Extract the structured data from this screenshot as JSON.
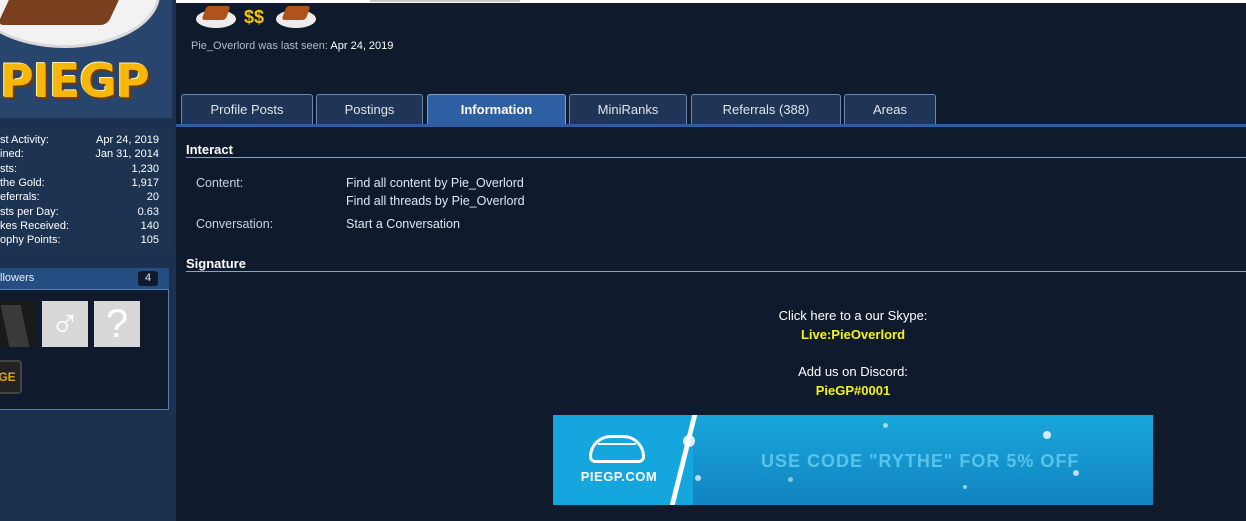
{
  "profile": {
    "username": "Pie_Overlord",
    "last_seen_prefix": "Pie_Overlord was last seen:",
    "last_seen_date": "Apr 24, 2019",
    "avatar_logo_text": "PIEGP"
  },
  "stats": [
    {
      "label": "st Activity:",
      "value": "Apr 24, 2019"
    },
    {
      "label": "ined:",
      "value": "Jan 31, 2014"
    },
    {
      "label": "sts:",
      "value": "1,230"
    },
    {
      "label": "the Gold:",
      "value": "1,917"
    },
    {
      "label": "eferrals:",
      "value": "20"
    },
    {
      "label": "sts per Day:",
      "value": "0.63"
    },
    {
      "label": "kes Received:",
      "value": "140"
    },
    {
      "label": "ophy Points:",
      "value": "105"
    }
  ],
  "followers": {
    "label": "llowers",
    "count": "4",
    "avatar_glyphs": [
      "♂",
      "?"
    ],
    "badge_text": "GE"
  },
  "tabs": [
    {
      "label": "Profile Posts",
      "active": false
    },
    {
      "label": "Postings",
      "active": false
    },
    {
      "label": "Information",
      "active": true
    },
    {
      "label": "MiniRanks",
      "active": false
    },
    {
      "label": "Referrals (388)",
      "active": false
    },
    {
      "label": "Areas",
      "active": false
    }
  ],
  "interact": {
    "heading": "Interact",
    "content_label": "Content:",
    "content_links": [
      "Find all content by Pie_Overlord",
      "Find all threads by Pie_Overlord"
    ],
    "conversation_label": "Conversation:",
    "conversation_link": "Start a Conversation"
  },
  "signature": {
    "heading": "Signature",
    "skype_prompt": "Click here to a our Skype:",
    "skype_id": "Live:PieOverlord",
    "discord_prompt": "Add us on Discord:",
    "discord_id": "PieGP#0001",
    "banner_brand": "PIEGP.COM",
    "banner_promo": "USE CODE \"RYTHE\" FOR 5% OFF"
  },
  "colors": {
    "page_bg": "#0f1b2d",
    "sidebar_bg": "#1b314f",
    "active_tab": "#2e5fa3",
    "signature_highlight": "#f7f21a"
  },
  "icons": [
    "pie-slice-icon",
    "gold-coins-icon",
    "pie-slice-icon"
  ]
}
